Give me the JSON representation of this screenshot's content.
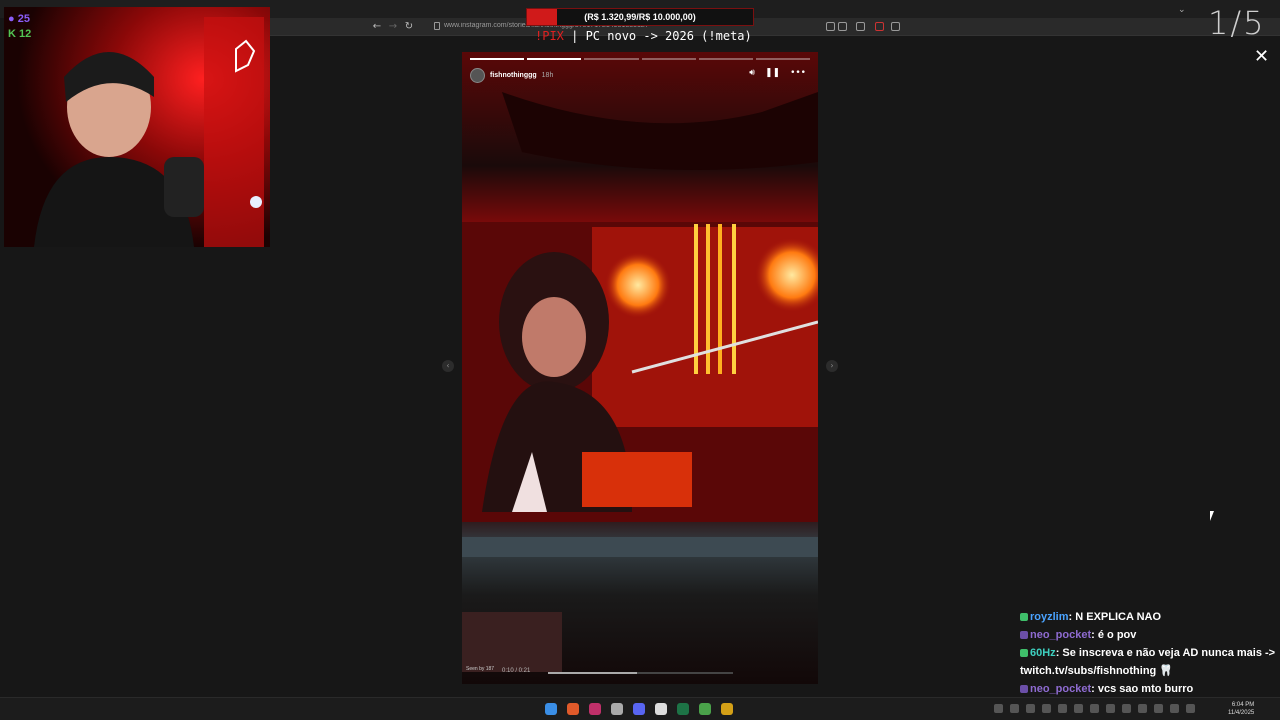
{
  "browser": {
    "url": "www.instagram.com/stories/fishnothinggg/3751717214981835127"
  },
  "donation_goal": {
    "text": "(R$ 1.320,99/R$ 10.000,00)",
    "progress": 0.132,
    "color": "#d01a1a"
  },
  "stream_command": {
    "prefix": "!PIX",
    "rest": " | PC novo -> 2026 (!meta)"
  },
  "viewers": {
    "twitch": "25",
    "kick": "12"
  },
  "counter": "1/5",
  "story": {
    "username": "fishnothinggg",
    "age": "18h",
    "time": "0:10 / 0:21",
    "video_progress": 0.48,
    "segments": 6,
    "current_segment": 2,
    "seen_by": "Seen by 187"
  },
  "chat": [
    {
      "user": "royzlim",
      "message": "N EXPLICA NAO",
      "user_color": "#4aa3ff"
    },
    {
      "user": "neo_pocket",
      "message": "é o pov",
      "user_color": "#8e6bd1"
    },
    {
      "user": "60Hz",
      "message": "Se inscreva e não veja AD nunca mais -> twitch.tv/subs/fishnothing 🦷",
      "user_color": "#3ed0c0"
    },
    {
      "user": "neo_pocket",
      "message": "vcs sao mto burro",
      "user_color": "#8e6bd1"
    }
  ],
  "taskbar": {
    "time": "6:04 PM",
    "date": "11/4/2025"
  },
  "icons": {
    "close": "close-icon",
    "volume": "volume-icon",
    "pause": "pause-icon",
    "more": "more-icon",
    "prev": "chevron-left-icon",
    "next": "chevron-right-icon"
  }
}
